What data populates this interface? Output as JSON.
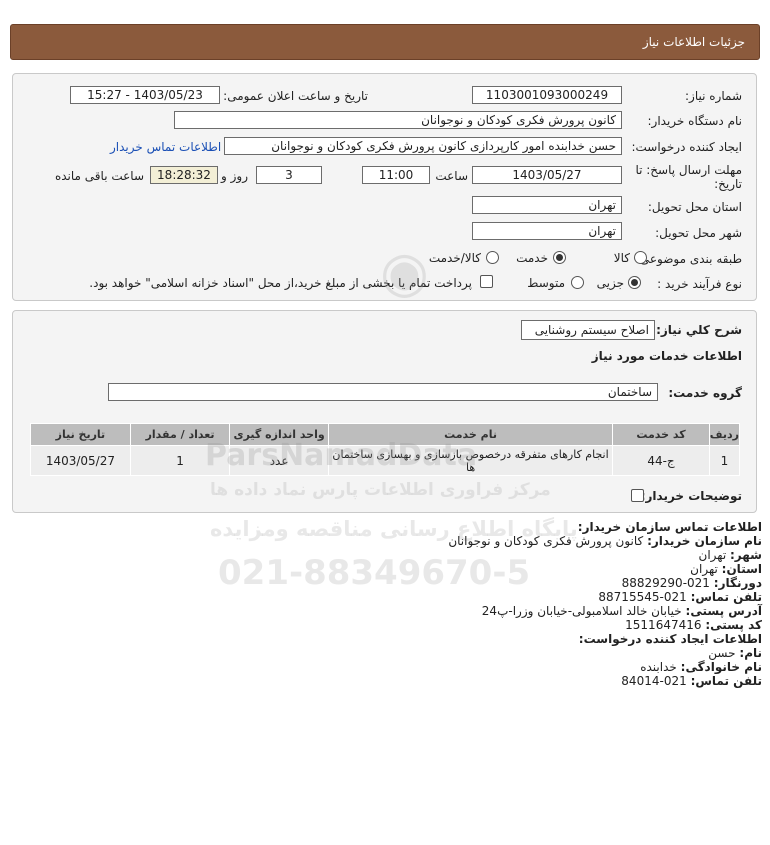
{
  "header": {
    "title": "جزئیات اطلاعات نیاز"
  },
  "form": {
    "need_number_label": "شماره نیاز:",
    "need_number": "1103001093000249",
    "announce_label": "تاریخ و ساعت اعلان عمومی:",
    "announce_value": "1403/05/23 - 15:27",
    "buyer_org_label": "نام دستگاه خریدار:",
    "buyer_org": "کانون پرورش فکری کودکان و نوجوانان",
    "creator_label": "ایجاد کننده درخواست:",
    "creator": "حسن خدابنده امور کارپردازی  کانون پرورش فکری کودکان و نوجوانان",
    "contact_link": "اطلاعات تماس خریدار",
    "deadline_label_1": "مهلت ارسال پاسخ: تا",
    "deadline_label_2": "تاریخ:",
    "deadline_date": "1403/05/27",
    "time_label": "ساعت",
    "deadline_time": "11:00",
    "days_value": "3",
    "days_label": "روز و",
    "remaining_time": "18:28:32",
    "remaining_label": "ساعت باقی مانده",
    "province_label": "استان محل تحویل:",
    "province": "تهران",
    "city_label": "شهر محل تحویل:",
    "city": "تهران",
    "category_label": "طبقه بندی موضوعی:",
    "category_options": [
      "کالا",
      "خدمت",
      "کالا/خدمت"
    ],
    "category_selected": "خدمت",
    "process_label": "نوع فرآیند خرید :",
    "process_options": [
      "جزیی",
      "متوسط"
    ],
    "process_selected": "جزیی",
    "payment_note": "پرداخت تمام یا بخشی از مبلغ خرید،از محل \"اسناد خزانه اسلامی\" خواهد بود."
  },
  "need": {
    "summary_label": "شرح کلي نياز:",
    "summary_value": "اصلاح سیستم روشنایی",
    "services_heading": "اطلاعات خدمات مورد نیاز",
    "service_group_label": "گروه خدمت:",
    "service_group_value": "ساختمان",
    "table_headers": [
      "ردیف",
      "کد خدمت",
      "نام خدمت",
      "واحد اندازه گیری",
      "تعداد / مقدار",
      "تاریخ نیاز"
    ],
    "rows": [
      {
        "row": "1",
        "code": "ج-44",
        "name": "انجام کارهای متفرقه درخصوص بازسازی و بهسازی ساختمان ها",
        "unit": "عدد",
        "qty": "1",
        "date": "1403/05/27"
      }
    ],
    "buyer_notes_label": "توضیحات خریدار:"
  },
  "contact": {
    "org_heading": "اطلاعات تماس سازمان خریدار:",
    "org_name_label": "نام سازمان خریدار:",
    "org_name": "کانون پرورش فکری کودکان و نوجوانان",
    "city_label": "شهر:",
    "city": "تهران",
    "province_label": "استان:",
    "province": "تهران",
    "fax_label": "دورنگار:",
    "fax": "021-88829290",
    "phone_label": "تلفن تماس:",
    "phone": "021-88715545",
    "address_label": "آدرس پستی:",
    "address": "خیابان خالد اسلامبولی-خیابان وزرا-پ24",
    "postal_label": "کد پستی:",
    "postal": "1511647416",
    "creator_heading": "اطلاعات ایجاد کننده درخواست:",
    "first_name_label": "نام:",
    "first_name": "حسن",
    "last_name_label": "نام خانوادگی:",
    "last_name": "خدابنده",
    "creator_phone_label": "تلفن تماس:",
    "creator_phone": "021-84014"
  },
  "watermark": {
    "brand": "ParsNamadData",
    "line1": "مرکز فراوری اطلاعات پارس نماد داده ها",
    "line2": "پایگاه اطلاع رسانی مناقصه ومزایده",
    "phone": "021-88349670-5"
  },
  "colors": {
    "header": "#8b5a3c",
    "panel": "#f4f4f4",
    "link": "#1a4fb5",
    "table_header": "#bdbdbd"
  }
}
